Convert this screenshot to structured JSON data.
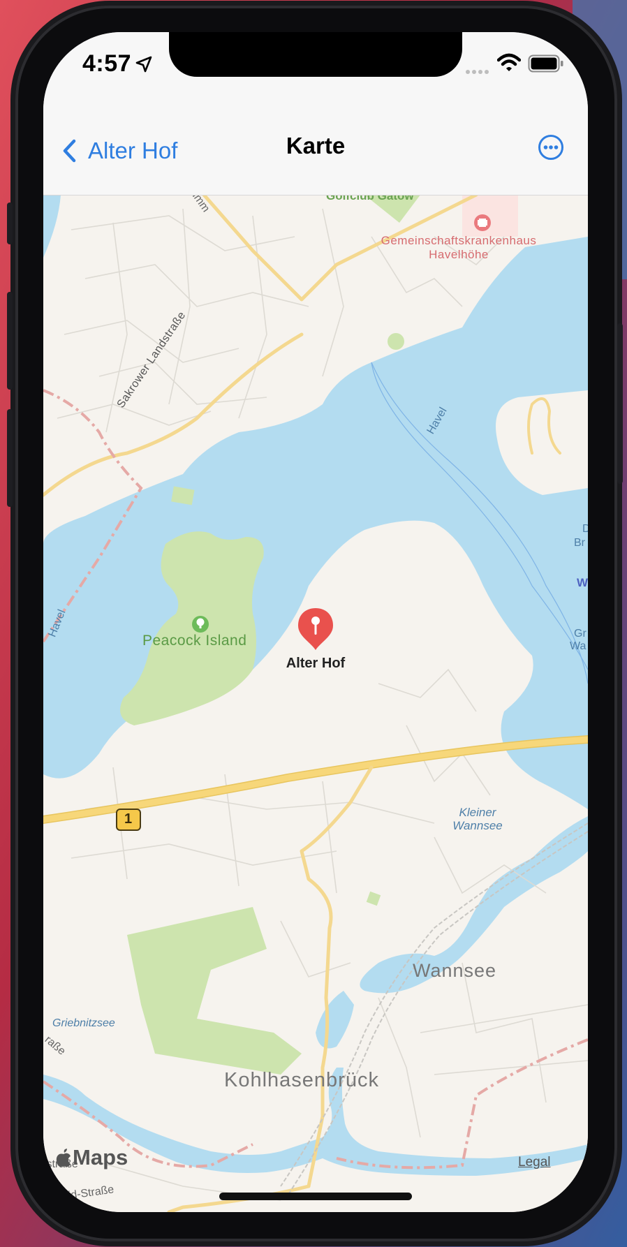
{
  "status_bar": {
    "time": "4:57"
  },
  "nav": {
    "back_label": "Alter Hof",
    "title": "Karte"
  },
  "map": {
    "places": {
      "golfclub": "Golfclub Gatow",
      "hospital": "Gemeinschaftskrankenhaus Havelhöhe",
      "sakrower": "Sakrower Landstraße",
      "havel_east": "Havel",
      "havel_west": "Havel",
      "peacock": "Peacock Island",
      "kleiner_wannsee": "Kleiner Wannsee",
      "wannsee": "Wannsee",
      "griebnitzsee": "Griebnitzsee",
      "kohlhasenbrueck": "Kohlhasenbrück",
      "road_shield": "1",
      "edge_d": "D",
      "edge_br": "Br",
      "edge_w": "W",
      "edge_gr": "Gr",
      "edge_wa": "Wa",
      "edge_strasse": "ıstraße",
      "edge_heid": "heid-Straße",
      "edge_rasse": "raße",
      "edge_umm": "umm"
    },
    "pin": {
      "label": "Alter Hof",
      "color": "#e9514d"
    },
    "attribution": {
      "logo_text": "Maps",
      "legal": "Legal"
    }
  },
  "colors": {
    "accent": "#2f7ee0",
    "water": "#b3dcf0",
    "land": "#f6f3ee",
    "park": "#cde4ae",
    "road": "#f7d77a"
  },
  "icons": {
    "back": "chevron-left-icon",
    "more": "ellipsis-circle-icon",
    "location": "location-arrow-icon",
    "wifi": "wifi-icon",
    "battery": "battery-icon",
    "hospital": "hospital-cross-icon",
    "tree": "tree-icon",
    "pin": "map-pin-icon",
    "apple": "apple-logo-icon"
  }
}
